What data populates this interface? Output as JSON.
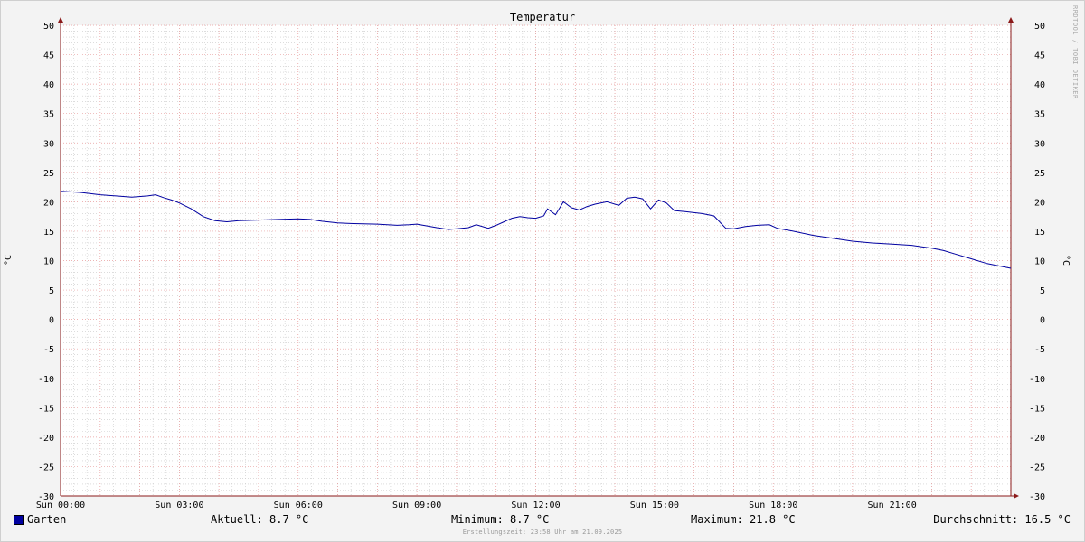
{
  "chart_data": {
    "type": "line",
    "title": "Temperatur",
    "ylabel": "°C",
    "ylim": [
      -30,
      50
    ],
    "yticks": [
      50,
      45,
      40,
      35,
      30,
      25,
      20,
      15,
      10,
      5,
      0,
      -5,
      -10,
      -15,
      -20,
      -25,
      -30
    ],
    "xlim": [
      0,
      24
    ],
    "xtick_labels": [
      "Sun 00:00",
      "Sun 03:00",
      "Sun 06:00",
      "Sun 09:00",
      "Sun 12:00",
      "Sun 15:00",
      "Sun 18:00",
      "Sun 21:00"
    ],
    "series": [
      {
        "name": "Garten",
        "color": "#0000a0",
        "x": [
          0,
          0.5,
          1.0,
          1.4,
          1.8,
          2.2,
          2.4,
          2.6,
          2.8,
          3.0,
          3.3,
          3.6,
          3.9,
          4.2,
          4.5,
          5.0,
          5.5,
          6.0,
          6.3,
          6.6,
          7.0,
          7.4,
          8.0,
          8.5,
          8.8,
          9.0,
          9.5,
          9.8,
          10.0,
          10.3,
          10.5,
          10.8,
          11.0,
          11.2,
          11.4,
          11.6,
          11.8,
          12.0,
          12.2,
          12.3,
          12.5,
          12.7,
          12.9,
          13.1,
          13.3,
          13.5,
          13.8,
          14.1,
          14.3,
          14.5,
          14.7,
          14.9,
          15.1,
          15.3,
          15.5,
          15.8,
          16.2,
          16.5,
          16.8,
          17.0,
          17.3,
          17.6,
          17.9,
          18.1,
          18.5,
          19.0,
          19.5,
          20.0,
          20.5,
          21.0,
          21.5,
          22.0,
          22.3,
          22.6,
          23.0,
          23.4,
          24.0
        ],
        "y": [
          21.8,
          21.6,
          21.2,
          21.0,
          20.8,
          21.0,
          21.2,
          20.7,
          20.3,
          19.8,
          18.8,
          17.5,
          16.8,
          16.6,
          16.8,
          16.9,
          17.0,
          17.1,
          17.0,
          16.7,
          16.4,
          16.3,
          16.2,
          16.0,
          16.1,
          16.2,
          15.6,
          15.3,
          15.4,
          15.6,
          16.1,
          15.5,
          16.0,
          16.6,
          17.2,
          17.5,
          17.3,
          17.2,
          17.6,
          18.8,
          17.8,
          20.0,
          19.0,
          18.6,
          19.2,
          19.6,
          20.0,
          19.4,
          20.6,
          20.8,
          20.5,
          18.8,
          20.3,
          19.8,
          18.5,
          18.3,
          18.0,
          17.6,
          15.5,
          15.4,
          15.8,
          16.0,
          16.1,
          15.5,
          15.0,
          14.3,
          13.8,
          13.3,
          13.0,
          12.8,
          12.6,
          12.1,
          11.7,
          11.1,
          10.3,
          9.5,
          8.7
        ]
      }
    ]
  },
  "legend": {
    "name": "Garten",
    "aktuell": "Aktuell: 8.7 °C",
    "minimum": "Minimum: 8.7 °C",
    "maximum": "Maximum: 21.8 °C",
    "durchschnitt": "Durchschnitt: 16.5 °C"
  },
  "footer": "Erstellungszeit: 23:58 Uhr am 21.09.2025",
  "watermark": "RRDTOOL / TOBI OETIKER",
  "colors": {
    "line": "#0000a0",
    "major_grid": "#e89a9a",
    "minor_grid": "#c8c8c8",
    "axis": "#8b1a1a"
  }
}
